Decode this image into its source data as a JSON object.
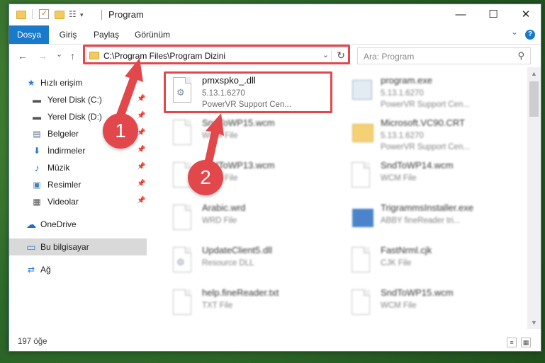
{
  "window": {
    "title": "Program",
    "minimize_glyph": "—",
    "maximize_glyph": "☐",
    "close_glyph": "✕"
  },
  "ribbon": {
    "tabs": [
      "Dosya",
      "Giriş",
      "Paylaş",
      "Görünüm"
    ],
    "expand_glyph": "⌄",
    "help_glyph": "?"
  },
  "nav": {
    "back_glyph": "←",
    "forward_glyph": "→",
    "recent_glyph": "⌄",
    "up_glyph": "↑",
    "address": "C:\\Program Files\\Program Dizini",
    "address_dropdown_glyph": "⌄",
    "refresh_glyph": "↻",
    "search_placeholder": "Ara: Program",
    "search_glyph": "⚲"
  },
  "sidebar": {
    "items": [
      {
        "label": "Hızlı erişim",
        "icon": "star-icon",
        "glyph": "★",
        "color": "#2d79d3"
      },
      {
        "label": "Yerel Disk (C:)",
        "icon": "drive-icon",
        "glyph": "▬",
        "color": "#555555",
        "pinned": true
      },
      {
        "label": "Yerel Disk (D:)",
        "icon": "drive-icon",
        "glyph": "▬",
        "color": "#555555",
        "pinned": true
      },
      {
        "label": "Belgeler",
        "icon": "documents-icon",
        "glyph": "▤",
        "color": "#5a6e8a",
        "pinned": true
      },
      {
        "label": "İndirmeler",
        "icon": "download-icon",
        "glyph": "⬇",
        "color": "#2d79d3",
        "pinned": true
      },
      {
        "label": "Müzik",
        "icon": "music-icon",
        "glyph": "♪",
        "color": "#2d79d3",
        "pinned": true
      },
      {
        "label": "Resimler",
        "icon": "pictures-icon",
        "glyph": "▣",
        "color": "#4a7fb5",
        "pinned": true
      },
      {
        "label": "Videolar",
        "icon": "videos-icon",
        "glyph": "▦",
        "color": "#555555",
        "pinned": true
      },
      {
        "label": "OneDrive",
        "icon": "cloud-icon",
        "glyph": "☁",
        "color": "#1a6fc9"
      },
      {
        "label": "Bu bilgisayar",
        "icon": "computer-icon",
        "glyph": "▭",
        "color": "#2d79d3",
        "selected": true
      },
      {
        "label": "Ağ",
        "icon": "network-icon",
        "glyph": "⇄",
        "color": "#2d79d3"
      }
    ],
    "pin_glyph": "📌"
  },
  "files": [
    {
      "name": "pmxspko_.dll",
      "version": "5.13.1.6270",
      "desc": "PowerVR Support Cen...",
      "kind": "dll",
      "blurred": false
    },
    {
      "name": "program.exe",
      "version": "5.13.1.6270",
      "desc": "PowerVR Support Cen...",
      "kind": "exe",
      "blurred": true
    },
    {
      "name": "SndToWP15.wcm",
      "version": "WCM File",
      "desc": "",
      "kind": "doc",
      "blurred": true
    },
    {
      "name": "Microsoft.VC90.CRT",
      "version": "5.13.1.6270",
      "desc": "PowerVR Support Cen...",
      "kind": "folder",
      "blurred": true
    },
    {
      "name": "SndToWP13.wcm",
      "version": "WCM File",
      "desc": "",
      "kind": "doc",
      "blurred": true
    },
    {
      "name": "SndToWP14.wcm",
      "version": "WCM File",
      "desc": "",
      "kind": "doc",
      "blurred": true
    },
    {
      "name": "Arabic.wrd",
      "version": "WRD File",
      "desc": "",
      "kind": "doc",
      "blurred": true
    },
    {
      "name": "TrigrammsInstaller.exe",
      "version": "ABBY fineReader tri...",
      "desc": "",
      "kind": "exe-blue",
      "blurred": true
    },
    {
      "name": "UpdateClient5.dll",
      "version": "Resource DLL",
      "desc": "",
      "kind": "dll",
      "blurred": true
    },
    {
      "name": "FastNrml.cjk",
      "version": "CJK File",
      "desc": "",
      "kind": "doc",
      "blurred": true
    },
    {
      "name": "help.fineReader.txt",
      "version": "TXT File",
      "desc": "",
      "kind": "doc",
      "blurred": true
    },
    {
      "name": "SndToWP15.wcm",
      "version": "WCM File",
      "desc": "",
      "kind": "doc",
      "blurred": true
    }
  ],
  "status": {
    "count": "197 öğe",
    "details_view_glyph": "≡",
    "icons_view_glyph": "▦"
  },
  "annotations": {
    "badge1": "1",
    "badge2": "2",
    "color": "#e2474b"
  }
}
